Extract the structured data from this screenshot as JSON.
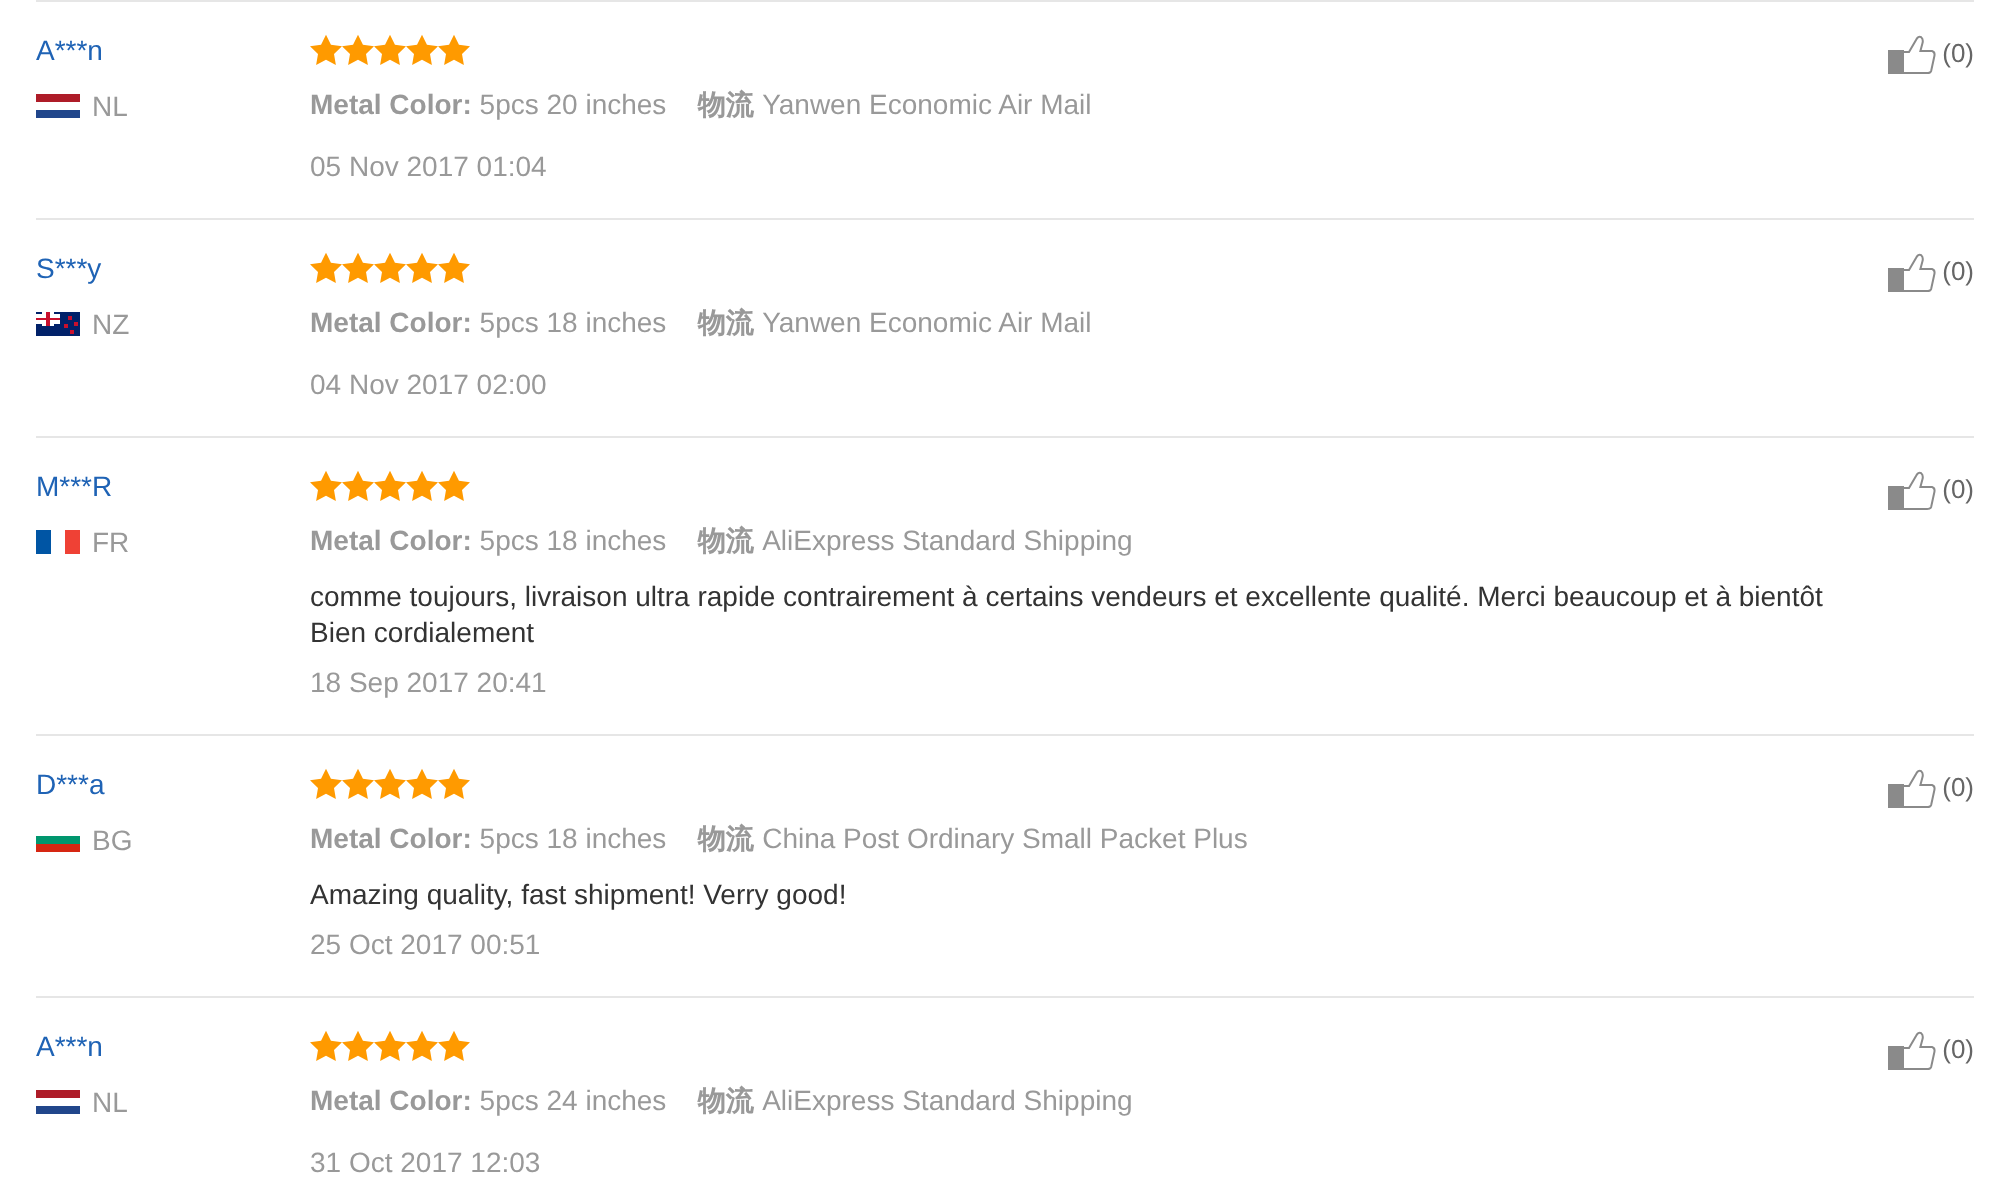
{
  "reviews": [
    {
      "name": "A***n",
      "country": "NL",
      "flag": {
        "kind": "horizontal",
        "colors": [
          {
            "color": "#ae1c28"
          },
          {
            "color": "#ffffff"
          },
          {
            "color": "#21468b"
          }
        ]
      },
      "stars": 5,
      "sku": "**Metal Color:** 5pcs 20 inches",
      "shipping": "**物流** Yanwen Economic Air Mail",
      "date": "05 Nov 2017 01:04",
      "likes": "(0)"
    },
    {
      "name": "S***y",
      "country": "NZ",
      "flag": {
        "kind": "ensign",
        "colors": [
          {
            "color": "#012169"
          },
          {
            "color": "#ffffff"
          },
          {
            "color": "#c8102e"
          }
        ]
      },
      "stars": 5,
      "sku": "**Metal Color:** 5pcs 18 inches",
      "shipping": "**物流** Yanwen Economic Air Mail",
      "date": "04 Nov 2017 02:00",
      "likes": "(0)"
    },
    {
      "name": "M***R",
      "country": "FR",
      "flag": {
        "kind": "vertical",
        "colors": [
          {
            "color": "#0055a4"
          },
          {
            "color": "#ffffff"
          },
          {
            "color": "#ef4135"
          }
        ]
      },
      "stars": 5,
      "sku": "**Metal Color:** 5pcs 18 inches",
      "shipping": "**物流** AliExpress Standard Shipping",
      "comment": "comme toujours, livraison ultra rapide contrairement à certains vendeurs et excellente qualité. Merci beaucoup et à bientôt\nBien cordialement",
      "date": "18 Sep 2017 20:41",
      "likes": "(0)"
    },
    {
      "name": "D***a",
      "country": "BG",
      "flag": {
        "kind": "horizontal",
        "colors": [
          {
            "color": "#ffffff"
          },
          {
            "color": "#00966e"
          },
          {
            "color": "#d62612"
          }
        ]
      },
      "stars": 5,
      "sku": "**Metal Color:** 5pcs 18 inches",
      "shipping": "**物流** China Post Ordinary Small Packet Plus",
      "comment": "Amazing quality, fast shipment! Verry good!",
      "date": "25 Oct 2017 00:51",
      "likes": "(0)"
    },
    {
      "name": "A***n",
      "country": "NL",
      "flag": {
        "kind": "horizontal",
        "colors": [
          {
            "color": "#ae1c28"
          },
          {
            "color": "#ffffff"
          },
          {
            "color": "#21468b"
          }
        ]
      },
      "stars": 5,
      "sku": "**Metal Color:** 5pcs 24 inches",
      "shipping": "**物流** AliExpress Standard Shipping",
      "date": "31 Oct 2017 12:03",
      "likes": "(0)"
    }
  ]
}
